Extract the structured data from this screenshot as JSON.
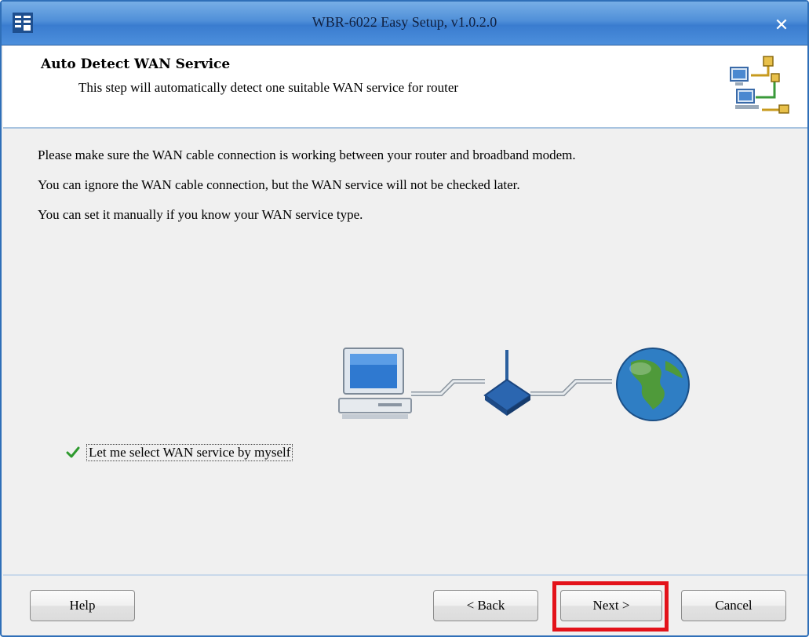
{
  "window": {
    "title": "WBR-6022 Easy Setup, v1.0.2.0",
    "close_glyph": "✕"
  },
  "header": {
    "title": "Auto Detect WAN Service",
    "subtitle": "This step will automatically detect one suitable WAN service for router",
    "icon": "network-setup-icon"
  },
  "body": {
    "paragraphs": [
      "Please make sure the WAN cable connection is working between your router and broadband modem.",
      "You can ignore the WAN cable connection, but the WAN service will not be checked later.",
      "You can set it manually if you know your WAN service type."
    ],
    "illustration_icons": [
      "computer-icon",
      "router-icon",
      "globe-icon"
    ]
  },
  "checkbox": {
    "label": "Let me select WAN service by myself",
    "checked": true
  },
  "buttons": {
    "help": "Help",
    "back": "< Back",
    "next": "Next >",
    "cancel": "Cancel"
  },
  "colors": {
    "title_bar": "#4f8fd8",
    "highlight": "#e3121a",
    "check": "#2e9a2e"
  }
}
